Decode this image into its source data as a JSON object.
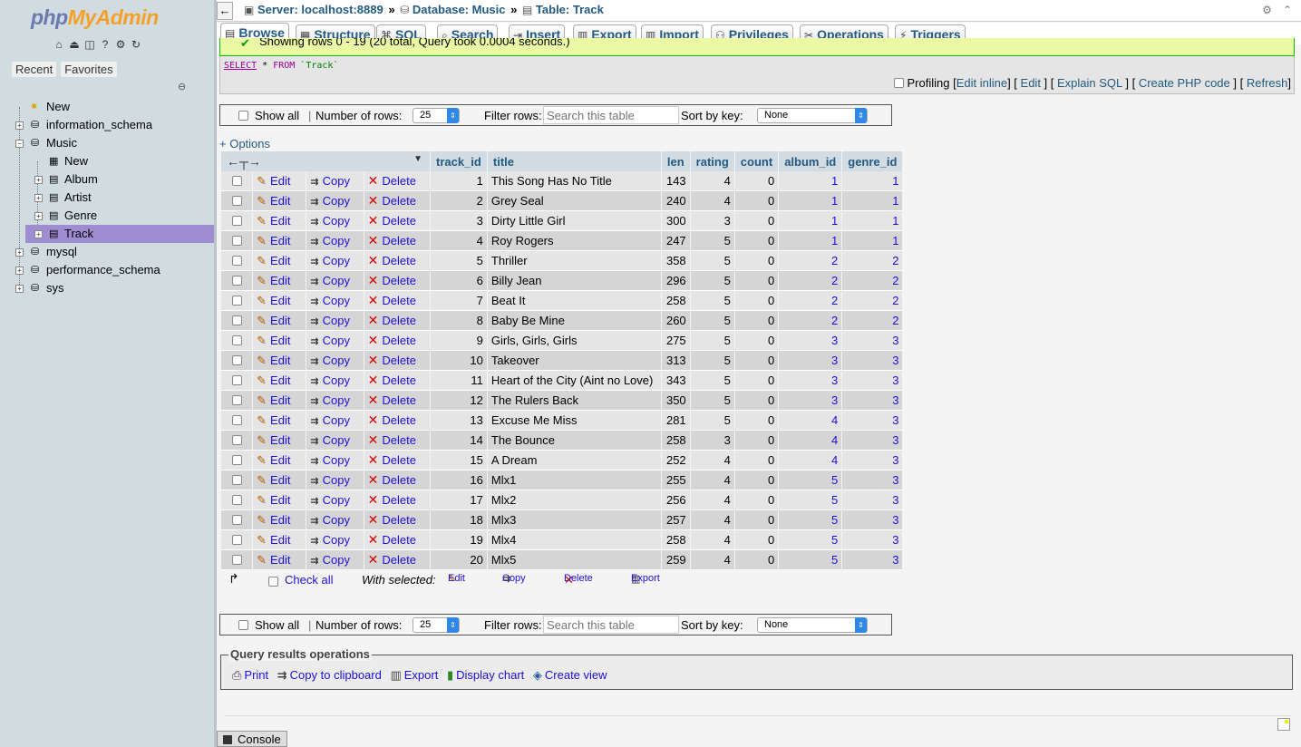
{
  "nav": {
    "logo_part1": "php",
    "logo_part2": "MyAdmin",
    "tab_recent": "Recent",
    "tab_favorites": "Favorites",
    "tree": [
      {
        "label": "New",
        "level": 0,
        "icon": "new-icon"
      },
      {
        "label": "information_schema",
        "level": 0,
        "icon": "database-icon"
      },
      {
        "label": "Music",
        "level": 0,
        "icon": "database-icon"
      },
      {
        "label": "New",
        "level": 1,
        "icon": "new-table-icon"
      },
      {
        "label": "Album",
        "level": 1,
        "icon": "table-icon"
      },
      {
        "label": "Artist",
        "level": 1,
        "icon": "table-icon"
      },
      {
        "label": "Genre",
        "level": 1,
        "icon": "table-icon"
      },
      {
        "label": "Track",
        "level": 1,
        "icon": "table-icon",
        "selected": true
      },
      {
        "label": "mysql",
        "level": 0,
        "icon": "database-icon"
      },
      {
        "label": "performance_schema",
        "level": 0,
        "icon": "database-icon"
      },
      {
        "label": "sys",
        "level": 0,
        "icon": "database-icon"
      }
    ]
  },
  "breadcrumb": {
    "server": "Server: localhost:8889",
    "database": "Database: Music",
    "table": "Table: Track",
    "sep": "»"
  },
  "tabs": [
    {
      "label": "Browse",
      "icon": "browse-icon",
      "active": true
    },
    {
      "label": "Structure",
      "icon": "structure-icon"
    },
    {
      "label": "SQL",
      "icon": "sql-icon"
    },
    {
      "label": "Search",
      "icon": "search-icon"
    },
    {
      "label": "Insert",
      "icon": "insert-icon"
    },
    {
      "label": "Export",
      "icon": "export-icon"
    },
    {
      "label": "Import",
      "icon": "import-icon"
    },
    {
      "label": "Privileges",
      "icon": "privileges-icon"
    },
    {
      "label": "Operations",
      "icon": "operations-icon"
    },
    {
      "label": "Triggers",
      "icon": "triggers-icon"
    }
  ],
  "message": "Showing rows 0 - 19 (20 total, Query took 0.0004 seconds.)",
  "sql": {
    "select": "SELECT",
    "star": " * ",
    "from": "FROM",
    "table": " `Track`",
    "profiling": "Profiling",
    "edit_inline": "Edit inline",
    "edit": "Edit",
    "explain": "Explain SQL",
    "php": "Create PHP code",
    "refresh": "Refresh"
  },
  "navbar": {
    "show_all": "Show all",
    "number_of_rows": "Number of rows:",
    "rows_value": "25",
    "filter_rows": "Filter rows:",
    "filter_placeholder": "Search this table",
    "sort_by_key": "Sort by key:",
    "sort_value": "None",
    "separator": "|"
  },
  "options": "+ Options",
  "columns": [
    "track_id",
    "title",
    "len",
    "rating",
    "count",
    "album_id",
    "genre_id"
  ],
  "row_actions": {
    "edit": "Edit",
    "copy": "Copy",
    "delete": "Delete"
  },
  "rows": [
    [
      1,
      "This Song Has No Title",
      143,
      4,
      0,
      1,
      1
    ],
    [
      2,
      "Grey Seal",
      240,
      4,
      0,
      1,
      1
    ],
    [
      3,
      "Dirty Little Girl",
      300,
      3,
      0,
      1,
      1
    ],
    [
      4,
      "Roy Rogers",
      247,
      5,
      0,
      1,
      1
    ],
    [
      5,
      "Thriller",
      358,
      5,
      0,
      2,
      2
    ],
    [
      6,
      "Billy Jean",
      296,
      5,
      0,
      2,
      2
    ],
    [
      7,
      "Beat It",
      258,
      5,
      0,
      2,
      2
    ],
    [
      8,
      "Baby Be Mine",
      260,
      5,
      0,
      2,
      2
    ],
    [
      9,
      "Girls, Girls, Girls",
      275,
      5,
      0,
      3,
      3
    ],
    [
      10,
      "Takeover",
      313,
      5,
      0,
      3,
      3
    ],
    [
      11,
      "Heart of the City (Aint no Love)",
      343,
      5,
      0,
      3,
      3
    ],
    [
      12,
      "The Rulers Back",
      350,
      5,
      0,
      3,
      3
    ],
    [
      13,
      "Excuse Me Miss",
      281,
      5,
      0,
      4,
      3
    ],
    [
      14,
      "The Bounce",
      258,
      3,
      0,
      4,
      3
    ],
    [
      15,
      "A Dream",
      252,
      4,
      0,
      4,
      3
    ],
    [
      16,
      "Mlx1",
      255,
      4,
      0,
      5,
      3
    ],
    [
      17,
      "Mlx2",
      256,
      4,
      0,
      5,
      3
    ],
    [
      18,
      "Mlx3",
      257,
      4,
      0,
      5,
      3
    ],
    [
      19,
      "Mlx4",
      258,
      4,
      0,
      5,
      3
    ],
    [
      20,
      "Mlx5",
      259,
      4,
      0,
      5,
      3
    ]
  ],
  "with_selected": {
    "check_all": "Check all",
    "label": "With selected:",
    "edit": "Edit",
    "copy": "Copy",
    "delete": "Delete",
    "export": "Export"
  },
  "query_ops": {
    "legend": "Query results operations",
    "print": "Print",
    "copy_clipboard": "Copy to clipboard",
    "export": "Export",
    "display_chart": "Display chart",
    "create_view": "Create view"
  },
  "console": "Console"
}
